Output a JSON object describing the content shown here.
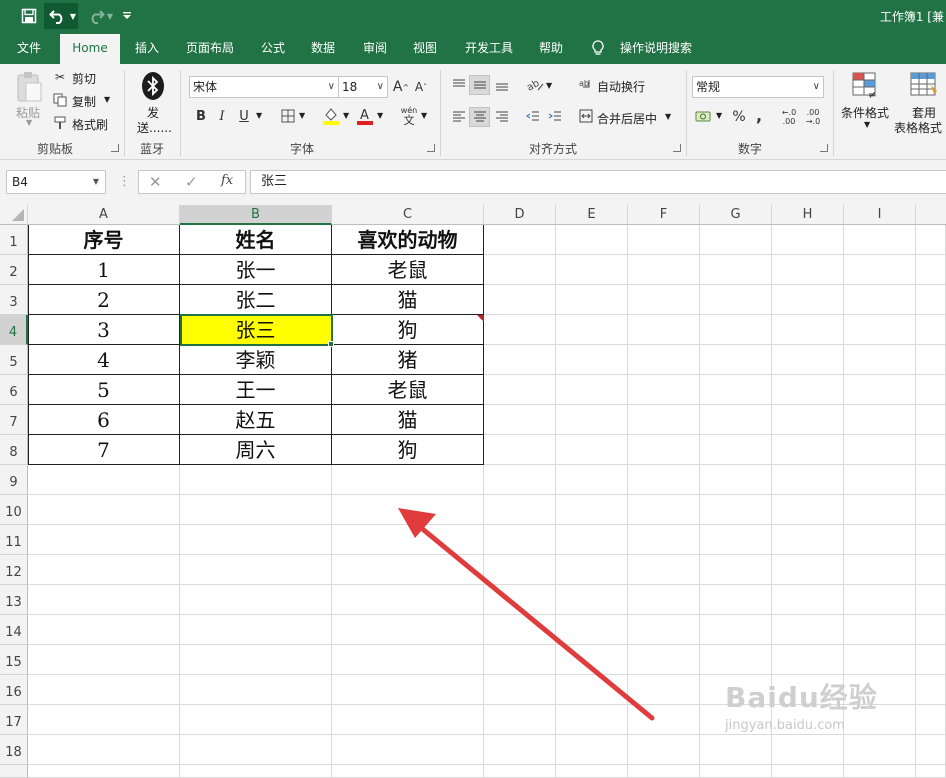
{
  "titlebar": {
    "title": "工作簿1 [兼",
    "undo_icon": "undo-icon",
    "redo_icon": "redo-icon",
    "save_icon": "save-icon"
  },
  "tabs": [
    "文件",
    "Home",
    "插入",
    "页面布局",
    "公式",
    "数据",
    "审阅",
    "视图",
    "开发工具",
    "帮助"
  ],
  "tell_me": "操作说明搜索",
  "ribbon": {
    "clipboard": {
      "paste": "粘贴",
      "cut": "剪切",
      "copy": "复制",
      "format_painter": "格式刷",
      "label": "剪贴板"
    },
    "bluetooth": {
      "send_line1": "发",
      "send_line2": "送......",
      "label": "蓝牙"
    },
    "font": {
      "name": "宋体",
      "size": "18",
      "bold": "B",
      "italic": "I",
      "underline": "U",
      "grow": "A",
      "shrink": "A",
      "phonetic_top": "wén",
      "phonetic_bottom": "文",
      "label": "字体"
    },
    "alignment": {
      "wrap": "自动换行",
      "merge": "合并后居中",
      "label": "对齐方式"
    },
    "number": {
      "format": "常规",
      "percent": "%",
      "comma": ",",
      "inc_dec": ".00",
      "label": "数字"
    },
    "styles": {
      "conditional": "条件格式",
      "table_line1": "套用",
      "table_line2": "表格格式"
    }
  },
  "formula_bar": {
    "name_box": "B4",
    "fx": "fx",
    "value": "张三"
  },
  "columns": [
    "A",
    "B",
    "C",
    "D",
    "E",
    "F",
    "G",
    "H",
    "I"
  ],
  "rows": [
    "1",
    "2",
    "3",
    "4",
    "5",
    "6",
    "7",
    "8",
    "9",
    "10",
    "11",
    "12",
    "13",
    "14",
    "15",
    "16",
    "17",
    "18"
  ],
  "table": {
    "headers": [
      "序号",
      "姓名",
      "喜欢的动物"
    ],
    "rows": [
      [
        "1",
        "张一",
        "老鼠"
      ],
      [
        "2",
        "张二",
        "猫"
      ],
      [
        "3",
        "张三",
        "狗"
      ],
      [
        "4",
        "李颖",
        "猪"
      ],
      [
        "5",
        "王一",
        "老鼠"
      ],
      [
        "6",
        "赵五",
        "猫"
      ],
      [
        "7",
        "周六",
        "狗"
      ]
    ]
  },
  "selected_cell": "B4",
  "colors": {
    "excel_green": "#217346",
    "highlight": "#ffff00",
    "arrow": "#e03c3c"
  },
  "watermark": {
    "brand": "Baidu经验",
    "url": "jingyan.baidu.com"
  }
}
